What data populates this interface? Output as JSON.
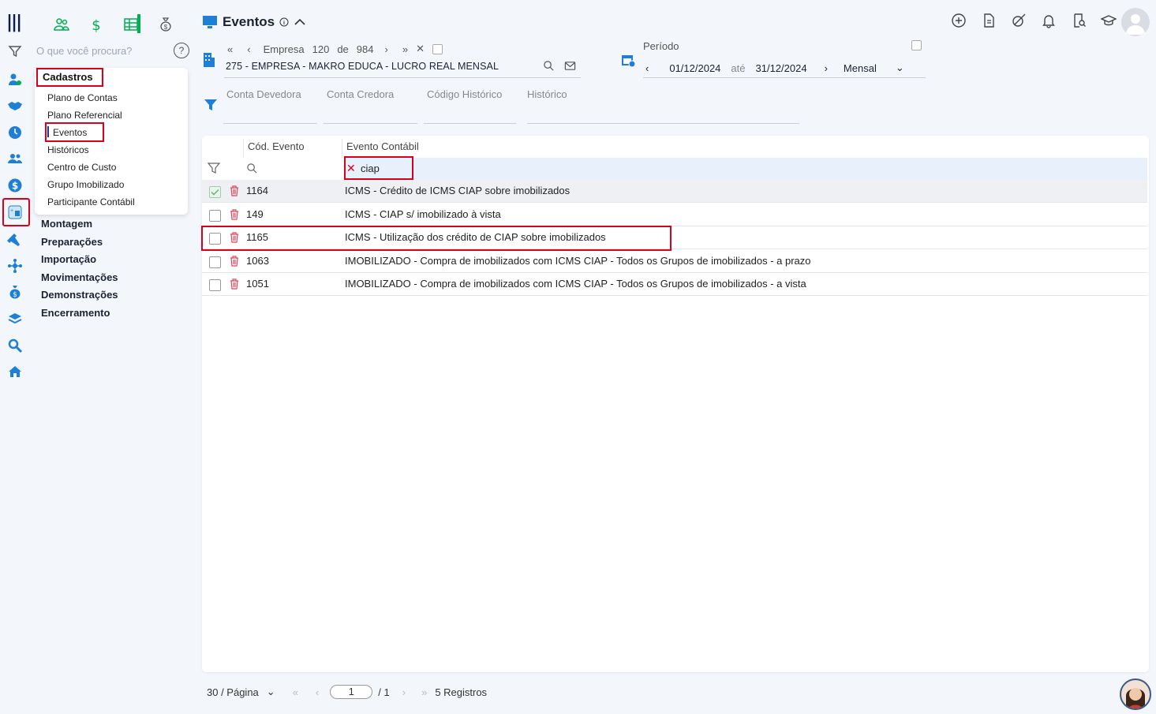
{
  "search": {
    "placeholder": "O que você procura?",
    "help": "?"
  },
  "menu": {
    "section_title": "Cadastros",
    "items": [
      "Plano de Contas",
      "Plano Referencial",
      "Eventos",
      "Históricos",
      "Centro de Custo",
      "Grupo Imobilizado",
      "Participante Contábil"
    ],
    "sections": [
      "Montagem",
      "Preparações",
      "Importação",
      "Movimentações",
      "Demonstrações",
      "Encerramento"
    ]
  },
  "header": {
    "title": "Eventos",
    "info": "i"
  },
  "empresa": {
    "nav_label": "Empresa",
    "current": "120",
    "de": "de",
    "total": "984",
    "name": "275 - EMPRESA - MAKRO EDUCA - LUCRO REAL MENSAL"
  },
  "periodo": {
    "label": "Período",
    "start": "01/12/2024",
    "ate": "até",
    "end": "31/12/2024",
    "type": "Mensal"
  },
  "filters": [
    "Conta Devedora",
    "Conta Credora",
    "Código Histórico",
    "Histórico"
  ],
  "table": {
    "columns": [
      "Cód. Evento",
      "Evento Contábil"
    ],
    "search_value": "ciap",
    "rows": [
      {
        "code": "1164",
        "desc": "ICMS - Crédito de ICMS CIAP sobre imobilizados",
        "checked": true
      },
      {
        "code": "149",
        "desc": "ICMS - CIAP s/ imobilizado à vista",
        "checked": false
      },
      {
        "code": "1165",
        "desc": "ICMS - Utilização dos crédito de CIAP sobre imobilizados",
        "checked": false
      },
      {
        "code": "1063",
        "desc": "IMOBILIZADO - Compra de imobilizados com ICMS CIAP - Todos os Grupos de imobilizados - a prazo",
        "checked": false
      },
      {
        "code": "1051",
        "desc": "IMOBILIZADO - Compra de imobilizados com ICMS CIAP - Todos os Grupos de imobilizados - a vista",
        "checked": false
      }
    ]
  },
  "pager": {
    "per_page": "30 / Página",
    "page": "1",
    "total_pages": "/ 1",
    "records": "5 Registros"
  },
  "colors": {
    "accent_blue": "#1e7fd6",
    "highlight_red": "#d9001b",
    "green": "#00b050",
    "navy": "#0e1b4d"
  }
}
